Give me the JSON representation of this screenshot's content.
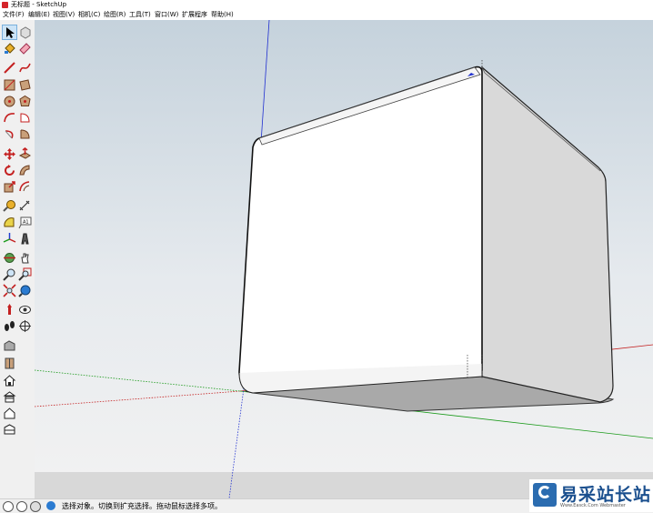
{
  "window": {
    "title": "无标题 - SketchUp"
  },
  "menu": [
    "文件(F)",
    "编辑(E)",
    "视图(V)",
    "相机(C)",
    "绘图(R)",
    "工具(T)",
    "窗口(W)",
    "扩展程序",
    "帮助(H)"
  ],
  "toolbar": {
    "tools": [
      "select-icon",
      "component-icon",
      "paint-bucket-icon",
      "eraser-icon",
      "line-icon",
      "freehand-icon",
      "rectangle-icon",
      "rotated-rectangle-icon",
      "circle-icon",
      "polygon-icon",
      "arc-icon",
      "pie-icon",
      "two-point-arc-icon",
      "three-point-arc-icon",
      "move-icon",
      "push-pull-icon",
      "rotate-icon",
      "follow-me-icon",
      "scale-icon",
      "offset-icon",
      "tape-measure-icon",
      "dimension-icon",
      "protractor-icon",
      "text-icon",
      "axes-icon",
      "3d-text-icon",
      "orbit-icon",
      "pan-icon",
      "zoom-icon",
      "zoom-window-icon",
      "zoom-extents-icon",
      "previous-view-icon",
      "position-camera-icon",
      "look-around-icon",
      "walk-icon",
      "section-plane-icon",
      "warehouse-icon",
      "extension-warehouse-icon",
      "house-icon",
      "house-section-icon",
      "house-outline-icon",
      "layers-icon"
    ]
  },
  "status": {
    "text": "选择对象。切换到扩充选择。拖动鼠标选择多项。"
  },
  "watermark": {
    "main": "易采站长站",
    "sub": "Www.Easck.Com Webmaster"
  }
}
